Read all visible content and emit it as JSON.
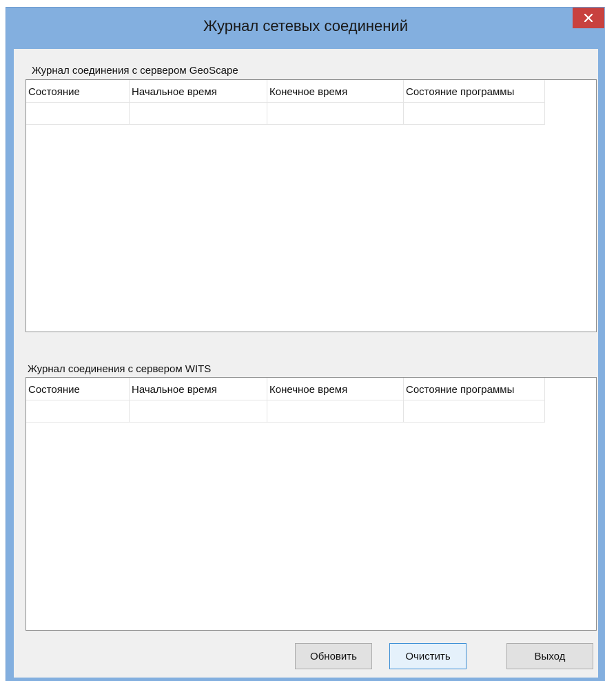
{
  "window": {
    "title": "Журнал сетевых соединений"
  },
  "geoscape_log": {
    "label": "Журнал соединения с сервером GeoScape",
    "columns": [
      "Состояние",
      "Начальное время",
      "Конечное время",
      "Состояние программы"
    ],
    "rows": []
  },
  "wits_log": {
    "label": "Журнал соединения с сервером WITS",
    "columns": [
      "Состояние",
      "Начальное время",
      "Конечное время",
      "Состояние программы"
    ],
    "rows": []
  },
  "buttons": {
    "refresh": "Обновить",
    "clear": "Очистить",
    "exit": "Выход"
  },
  "colors": {
    "frame": "#83afdf",
    "close": "#c8413f",
    "focus_border": "#3c8fd6"
  }
}
